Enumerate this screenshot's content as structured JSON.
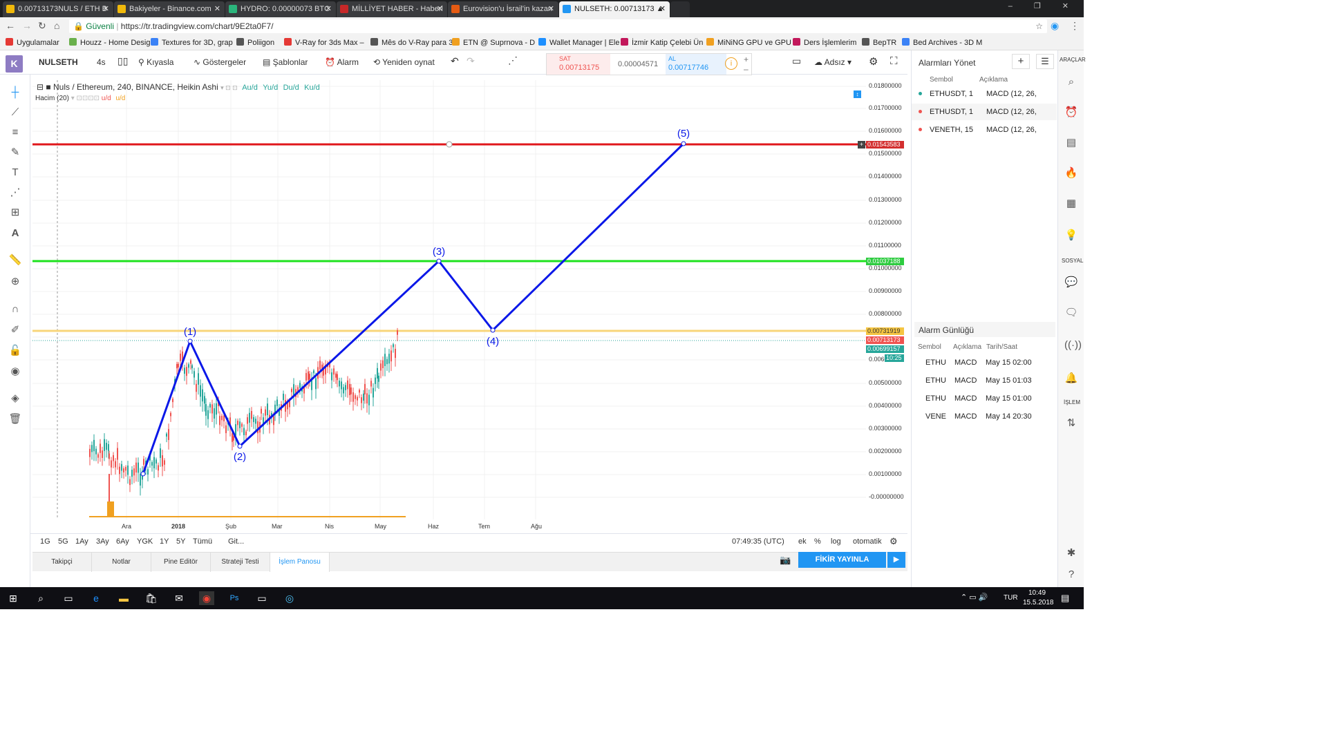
{
  "browser": {
    "tabs": [
      {
        "label": "0.00713173NULS / ETH B",
        "color": "#f0b90b"
      },
      {
        "label": "Bakiyeler - Binance.com",
        "color": "#f0b90b"
      },
      {
        "label": "HYDRO: 0.00000073 BTC",
        "color": "#2bb57c"
      },
      {
        "label": "MİLLİYET HABER - Haberl",
        "color": "#c62828"
      },
      {
        "label": "Eurovision'u İsrail'in kazan",
        "color": "#e55b13"
      },
      {
        "label": "NULSETH: 0.00713173 ▲",
        "color": "#2196f3"
      }
    ],
    "secure_label": "Güvenli",
    "url": "https://tr.tradingview.com/chart/9E2ta0F7/",
    "bookmarks": [
      "Uygulamalar",
      "Houzz - Home Desig",
      "Textures for 3D, grap",
      "Poliigon",
      "V-Ray for 3ds Max –",
      "Mês do V-Ray para 3",
      "ETN @ Suprnova - D",
      "Wallet Manager | Ele",
      "İzmir Katip Çelebi Ün",
      "MiNiNG GPU ve GPU",
      "Ders İşlemlerim",
      "BepTR",
      "Bed Archives - 3D M"
    ]
  },
  "toolbar": {
    "logo": "K",
    "symbol": "NULSETH",
    "interval": "4s",
    "compare": "Kıyasla",
    "indicators": "Göstergeler",
    "templates": "Şablonlar",
    "alert": "Alarm",
    "replay": "Yeniden oynat",
    "sell_label": "SAT",
    "sell_price": "0.00713175",
    "spread": "0.00004571",
    "buy_label": "AL",
    "buy_price": "0.00717746",
    "layout_name": "Adsız"
  },
  "chart": {
    "title": "Nuls / Ethereum, 240, BINANCE, Heikin Ashi",
    "ohlc": [
      "A",
      "u/d",
      "Y",
      "u/d",
      "D",
      "u/d",
      "K",
      "u/d"
    ],
    "ohlc_text": [
      "Au/d",
      "Yu/d",
      "Du/d",
      "Ku/d"
    ],
    "volume_label": "Hacim (20)",
    "volume_ud": [
      "u/d",
      "u/d"
    ],
    "price_labels": [
      "0.01800000",
      "0.01700000",
      "0.01600000",
      "0.01500000",
      "0.01400000",
      "0.01300000",
      "0.01200000",
      "0.01100000",
      "0.01000000",
      "0.00900000",
      "0.00800000",
      "0.00600",
      "0.00500000",
      "0.00400000",
      "0.00300000",
      "0.00200000",
      "0.00100000",
      "-0.00000000"
    ],
    "badges": [
      {
        "text": "0.01543583",
        "color": "#d32f2f"
      },
      {
        "text": "0.01037188",
        "color": "#2ecc40"
      },
      {
        "text": "0.00731919",
        "color": "#f5c542"
      },
      {
        "text": "0.00713173",
        "color": "#ef5350"
      },
      {
        "text": "0.00699157",
        "color": "#26a69a"
      },
      {
        "text": "10:25",
        "color": "#26a69a"
      }
    ],
    "x_labels": [
      "Ara",
      "2018",
      "Şub",
      "Mar",
      "Nis",
      "May",
      "Haz",
      "Tem",
      "Ağu"
    ],
    "wave_labels": [
      "(1)",
      "(2)",
      "(3)",
      "(4)",
      "(5)"
    ],
    "line_colors": {
      "red": "#e0171b",
      "green": "#1de21d",
      "yellow": "#f8d57a",
      "wave": "#0b18e8"
    }
  },
  "range_bar": {
    "ranges": [
      "1G",
      "5G",
      "1Ay",
      "3Ay",
      "6Ay",
      "YGK",
      "1Y",
      "5Y",
      "Tümü"
    ],
    "goto": "Git...",
    "time": "07:49:35 (UTC)",
    "ek": "ek",
    "percent": "%",
    "log": "log",
    "auto": "otomatik"
  },
  "bottom_tabs": [
    "Takipçi",
    "Notlar",
    "Pine Editör",
    "Strateji Testi",
    "İşlem Panosu"
  ],
  "publish": "FİKİR YAYINLA",
  "alerts": {
    "title": "Alarmları Yönet",
    "col_symbol": "Sembol",
    "col_desc": "Açıklama",
    "items": [
      {
        "symbol": "ETHUSDT, 1",
        "desc": "MACD (12, 26,",
        "color": "#26a69a"
      },
      {
        "symbol": "ETHUSDT, 1",
        "desc": "MACD (12, 26,",
        "color": "#ef5350"
      },
      {
        "symbol": "VENETH, 15",
        "desc": "MACD (12, 26,",
        "color": "#ef5350"
      }
    ]
  },
  "log": {
    "title": "Alarm Günlüğü",
    "cols": [
      "Sembol",
      "Açıklama",
      "Tarih/Saat"
    ],
    "rows": [
      {
        "s": "ETHU",
        "d": "MACD",
        "t": "May 15 02:00"
      },
      {
        "s": "ETHU",
        "d": "MACD",
        "t": "May 15 01:03"
      },
      {
        "s": "ETHU",
        "d": "MACD",
        "t": "May 15 01:00"
      },
      {
        "s": "VENE",
        "d": "MACD",
        "t": "May 14 20:30"
      }
    ]
  },
  "sidebar": {
    "araclar": "ARAÇLAR",
    "sosyal": "SOSYAL",
    "islem": "İŞLEM"
  },
  "taskbar": {
    "lang": "TUR",
    "time": "10:49",
    "date": "15.5.2018"
  }
}
